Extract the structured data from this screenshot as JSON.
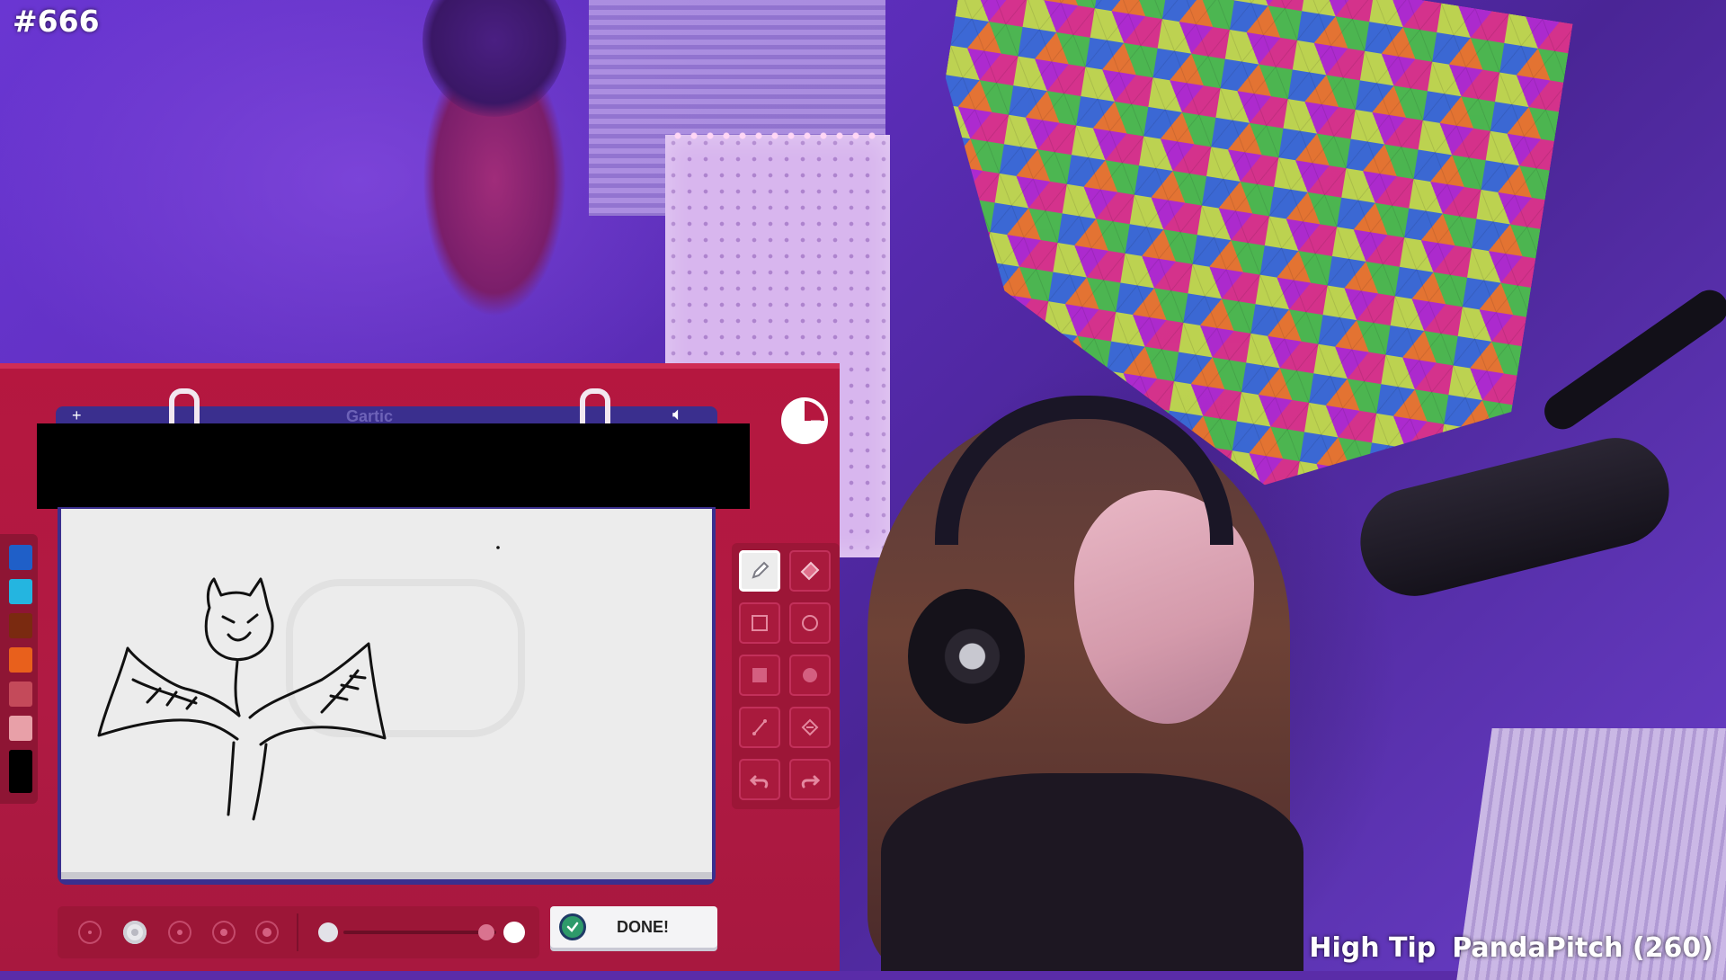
{
  "overlay": {
    "stream_counter": "#666",
    "high_tip_label": "High Tip",
    "high_tip_value": "PandaPitch (260)"
  },
  "game": {
    "sketchbook_title": "Gartic",
    "done_label": "DONE!",
    "palette_colors": [
      "#1f5fc8",
      "#24b5e0",
      "#7a2a10",
      "#e8601c",
      "#c44a5a",
      "#e8a0a8",
      "#000000"
    ],
    "tools": [
      {
        "name": "pencil-tool",
        "icon": "pencil-icon",
        "active": true
      },
      {
        "name": "eraser-tool",
        "icon": "eraser-icon",
        "active": false
      },
      {
        "name": "rectangle-outline-tool",
        "icon": "square-outline-icon",
        "active": false
      },
      {
        "name": "circle-outline-tool",
        "icon": "circle-outline-icon",
        "active": false
      },
      {
        "name": "rectangle-fill-tool",
        "icon": "square-fill-icon",
        "active": false
      },
      {
        "name": "circle-fill-tool",
        "icon": "circle-fill-icon",
        "active": false
      },
      {
        "name": "line-tool",
        "icon": "line-icon",
        "active": false
      },
      {
        "name": "bucket-tool",
        "icon": "bucket-icon",
        "active": false
      },
      {
        "name": "undo-button",
        "icon": "undo-icon",
        "active": false
      },
      {
        "name": "redo-button",
        "icon": "redo-icon",
        "active": false
      }
    ],
    "brush_sizes": 5,
    "selected_brush_size": 2
  },
  "colors": {
    "panel": "#b5173f",
    "sketch_header": "#3a2f8e",
    "done_check": "#2e9a6a"
  }
}
